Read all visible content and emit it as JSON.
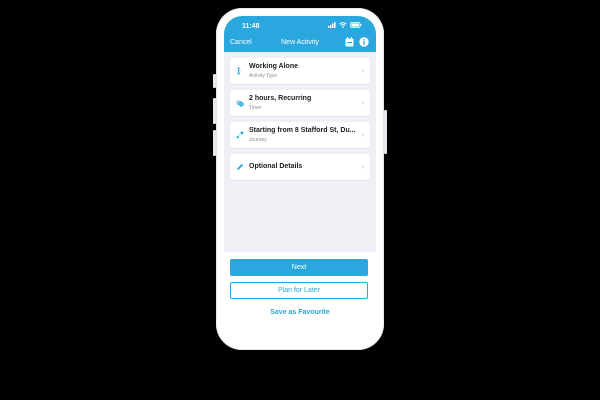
{
  "status_bar": {
    "time": "11:48",
    "icons": [
      "signal-icon",
      "wifi-icon",
      "battery-icon"
    ]
  },
  "nav": {
    "cancel": "Cancel",
    "title": "New Activity",
    "icons": [
      "calendar-icon",
      "info-icon"
    ]
  },
  "activity_items": [
    {
      "title": "Working Alone",
      "subtitle": "Activity Type",
      "icon": "person-walking-icon"
    },
    {
      "title": "2 hours, Recurring",
      "subtitle": "Timer",
      "icon": "timer-icon"
    },
    {
      "title": "Starting from 8 Stafford St, Du...",
      "subtitle": "Journey",
      "icon": "route-icon"
    },
    {
      "title": "Optional Details",
      "subtitle": "",
      "icon": "pencil-icon"
    }
  ],
  "actions": {
    "next": "Next",
    "plan_later": "Plan for Later",
    "favourite": "Save as Favourite"
  },
  "colors": {
    "accent": "#2aa7de",
    "background": "#000000",
    "content_bg": "#eef0f5"
  }
}
